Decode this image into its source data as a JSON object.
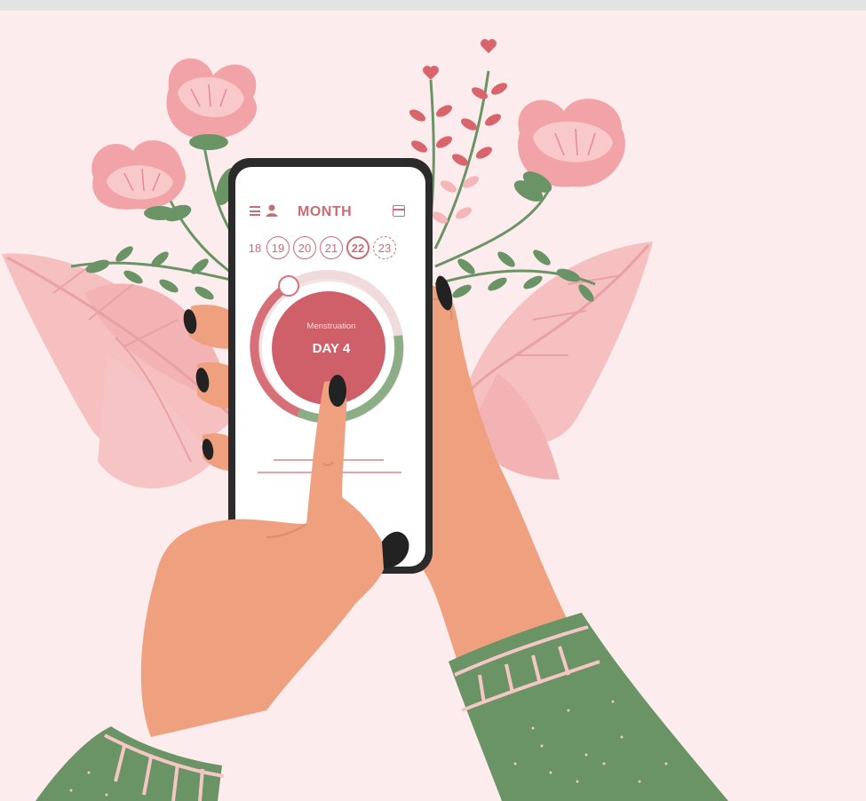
{
  "app": {
    "view_title": "MONTH",
    "icons": {
      "menu": "hamburger-menu-icon",
      "profile": "person-icon",
      "calendar": "calendar-icon"
    },
    "days": [
      {
        "label": "18",
        "state": "plain"
      },
      {
        "label": "19",
        "state": "ring"
      },
      {
        "label": "20",
        "state": "ring"
      },
      {
        "label": "21",
        "state": "ring"
      },
      {
        "label": "22",
        "state": "today"
      },
      {
        "label": "23",
        "state": "future"
      }
    ],
    "cycle": {
      "phase": "Menstruation",
      "day_text": "DAY 4"
    }
  },
  "colors": {
    "background": "#fdeced",
    "accent": "#c86d76",
    "cycle_circle": "#cf5f69",
    "green": "#6b9466",
    "skin": "#eea07f",
    "nail": "#222222"
  }
}
